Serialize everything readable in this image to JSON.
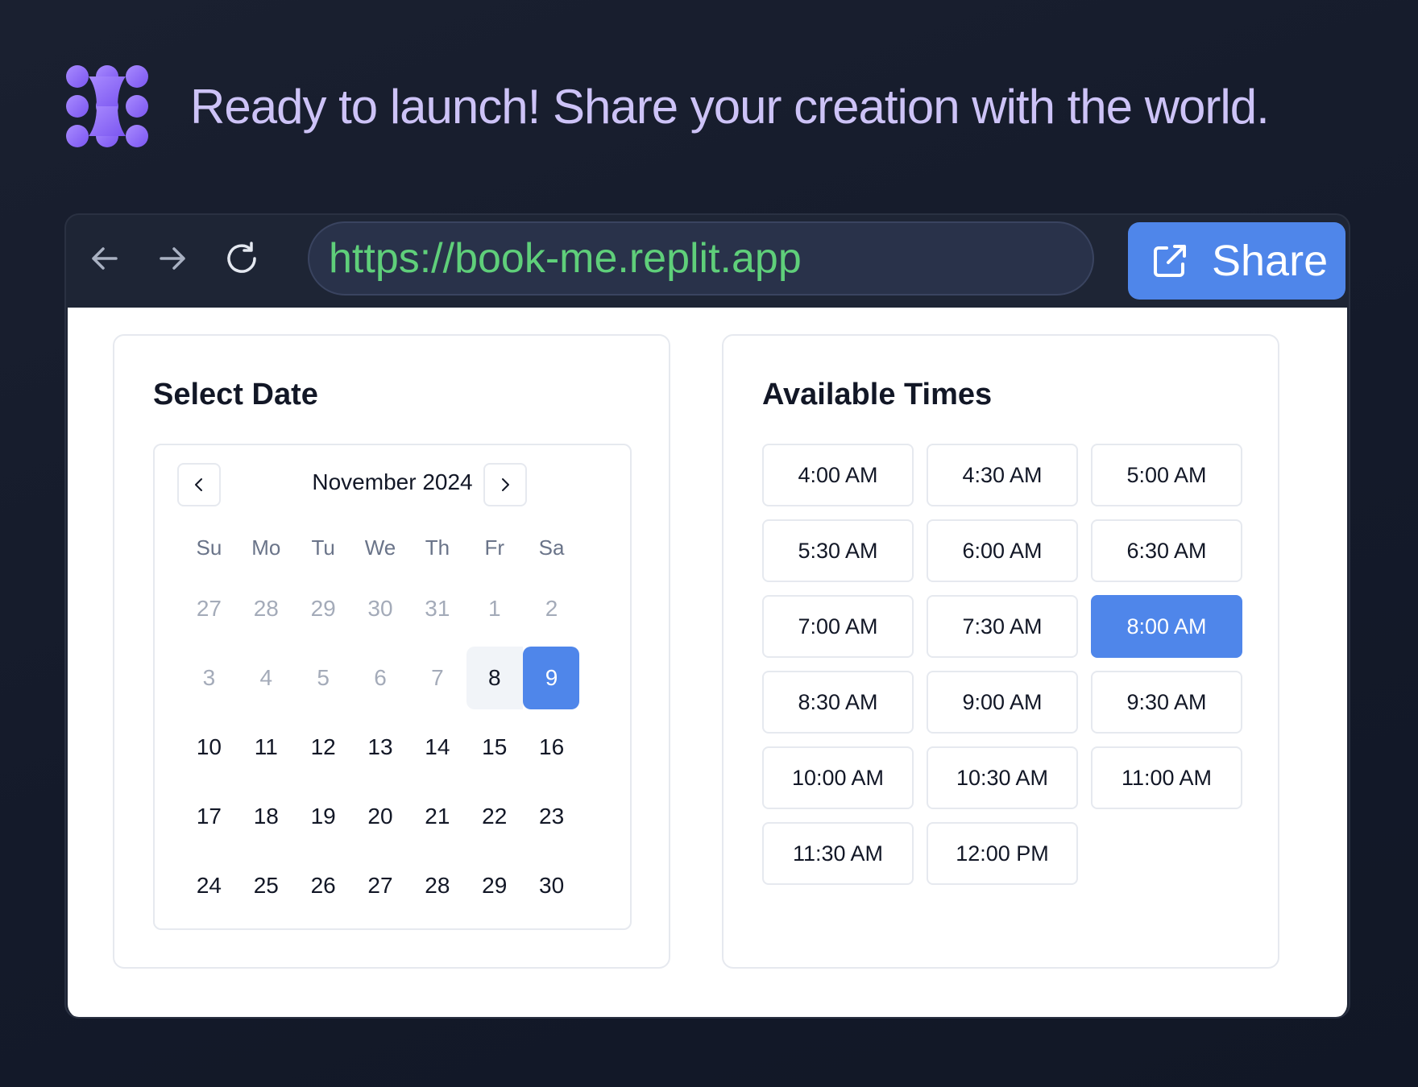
{
  "headline": {
    "text": "Ready to launch! Share your creation with the world."
  },
  "browser": {
    "url": "https://book-me.replit.app",
    "share_label": "Share"
  },
  "date_panel": {
    "title": "Select Date",
    "month_label": "November 2024",
    "weekdays": [
      "Su",
      "Mo",
      "Tu",
      "We",
      "Th",
      "Fr",
      "Sa"
    ],
    "weeks": [
      [
        {
          "d": "27",
          "out": true
        },
        {
          "d": "28",
          "out": true
        },
        {
          "d": "29",
          "out": true
        },
        {
          "d": "30",
          "out": true
        },
        {
          "d": "31",
          "out": true
        },
        {
          "d": "1",
          "out": true
        },
        {
          "d": "2",
          "out": true
        }
      ],
      [
        {
          "d": "3",
          "out": true
        },
        {
          "d": "4",
          "out": true
        },
        {
          "d": "5",
          "out": true
        },
        {
          "d": "6",
          "out": true
        },
        {
          "d": "7",
          "out": true
        },
        {
          "d": "8",
          "today": true
        },
        {
          "d": "9",
          "selected": true
        }
      ],
      [
        {
          "d": "10"
        },
        {
          "d": "11"
        },
        {
          "d": "12"
        },
        {
          "d": "13"
        },
        {
          "d": "14"
        },
        {
          "d": "15"
        },
        {
          "d": "16"
        }
      ],
      [
        {
          "d": "17"
        },
        {
          "d": "18"
        },
        {
          "d": "19"
        },
        {
          "d": "20"
        },
        {
          "d": "21"
        },
        {
          "d": "22"
        },
        {
          "d": "23"
        }
      ],
      [
        {
          "d": "24"
        },
        {
          "d": "25"
        },
        {
          "d": "26"
        },
        {
          "d": "27"
        },
        {
          "d": "28"
        },
        {
          "d": "29"
        },
        {
          "d": "30"
        }
      ]
    ]
  },
  "times_panel": {
    "title": "Available Times",
    "selected": "8:00 AM",
    "slots": [
      "4:00 AM",
      "4:30 AM",
      "5:00 AM",
      "5:30 AM",
      "6:00 AM",
      "6:30 AM",
      "7:00 AM",
      "7:30 AM",
      "8:00 AM",
      "8:30 AM",
      "9:00 AM",
      "9:30 AM",
      "10:00 AM",
      "10:30 AM",
      "11:00 AM",
      "11:30 AM",
      "12:00 PM"
    ]
  },
  "colors": {
    "accent": "#4f86ea",
    "headline": "#cdc3f7",
    "url_text": "#5fcf7a",
    "logo": "#8f6cf5"
  },
  "icons": {
    "logo": "replit-logo-icon",
    "back": "arrow-left-icon",
    "forward": "arrow-right-icon",
    "reload": "reload-icon",
    "share": "external-link-icon",
    "prev_month": "chevron-left-icon",
    "next_month": "chevron-right-icon"
  }
}
